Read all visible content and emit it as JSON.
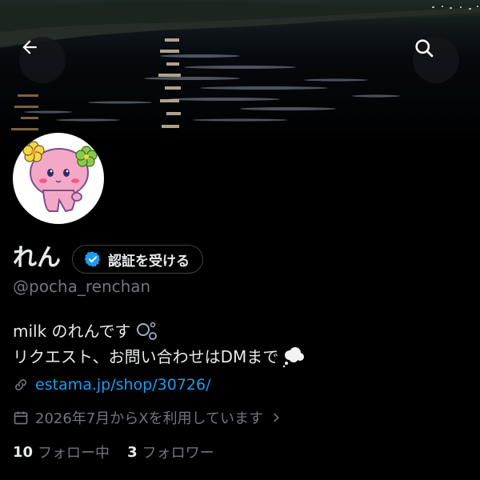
{
  "profile": {
    "name": "れん",
    "verify_label": "認証を受ける",
    "handle": "@pocha_renchan",
    "bio_line1": "milk のれんです",
    "bio_line2": "リクエスト、お問い合わせはDMまで",
    "link": "estama.jp/shop/30726/",
    "joined": "2026年7月からXを利用しています",
    "following_count": "10",
    "following_label": "フォロー中",
    "followers_count": "3",
    "followers_label": "フォロワー"
  },
  "icons": {
    "back": "arrow-left-icon",
    "search": "search-icon",
    "verified": "verified-badge-icon",
    "link": "link-icon",
    "calendar": "calendar-icon",
    "chevron": "chevron-right-icon"
  },
  "colors": {
    "background": "#000000",
    "text_primary": "#e7e9ea",
    "text_secondary": "#71767b",
    "accent": "#1d9bf0"
  }
}
